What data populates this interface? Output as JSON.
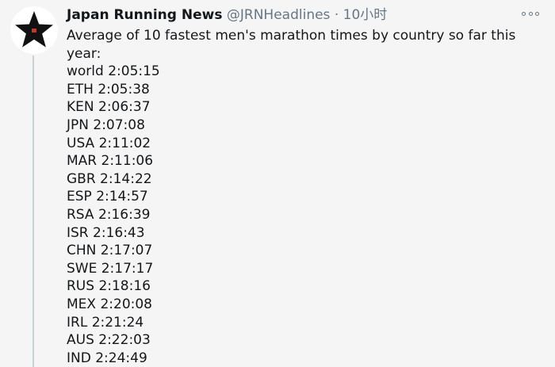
{
  "tweet": {
    "display_name": "Japan Running News",
    "handle": "@JRNHeadlines",
    "separator": "·",
    "time": "10小时",
    "intro": "Average of 10 fastest men's marathon times by country so far this",
    "intro_cont": "year:",
    "times": [
      "world 2:05:15",
      "ETH 2:05:38",
      "KEN 2:06:37",
      "JPN 2:07:08",
      "USA 2:11:02",
      "MAR 2:11:06",
      "GBR 2:14:22",
      "ESP 2:14:57",
      "RSA 2:16:39",
      "ISR 2:16:43",
      "CHN 2:17:07",
      "SWE 2:17:17",
      "RUS 2:18:16",
      "MEX 2:20:08",
      "IRL 2:21:24",
      "AUS 2:22:03",
      "IND 2:24:49"
    ]
  },
  "icons": {
    "avatar": "black-star-logo",
    "more": "more-options-icon"
  },
  "colors": {
    "background": "#f5f5f5",
    "text": "#14171a",
    "muted": "#657786",
    "thread_line": "#c8d2d8",
    "logo_star": "#111111",
    "logo_accent": "#c0392b"
  }
}
